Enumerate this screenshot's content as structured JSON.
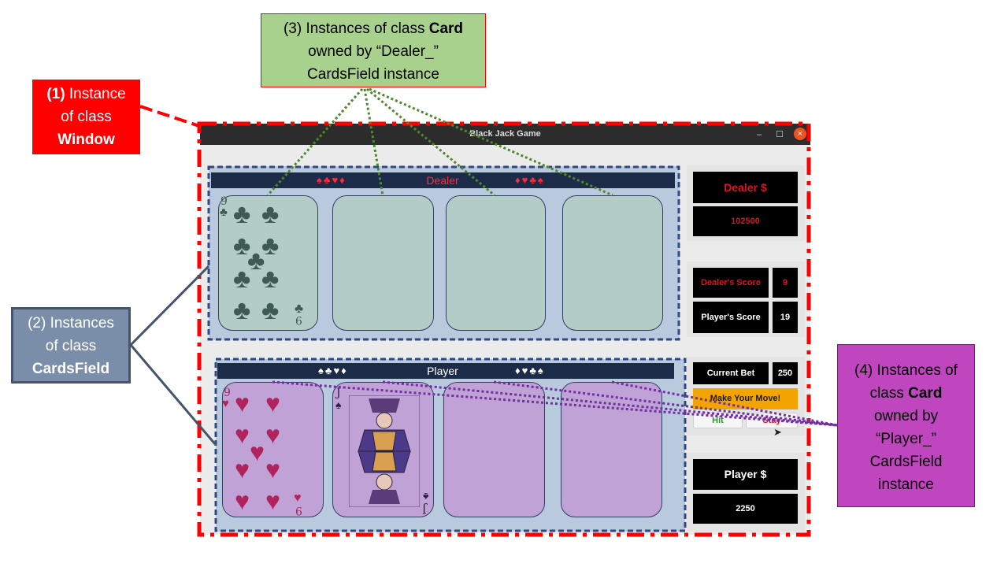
{
  "window": {
    "title": "Black Jack Game",
    "controls": {
      "minimize": "–",
      "maximize": "☐",
      "close": "×"
    }
  },
  "dealer_field": {
    "suits_left": "♠♣♥♦",
    "label": "Dealer",
    "suits_right": "♦♥♣♠",
    "card1": {
      "rank": "9",
      "suit": "♣"
    }
  },
  "player_field": {
    "suits_left": "♠♣♥♦",
    "label": "Player",
    "suits_right": "♦♥♣♠",
    "card1": {
      "rank": "9",
      "suit": "♥"
    },
    "card2": {
      "rank": "J",
      "suit": "♠"
    }
  },
  "side": {
    "dealer_money_label": "Dealer $",
    "dealer_money_value": "102500",
    "dealer_score_label": "Dealer's Score",
    "dealer_score_value": "9",
    "player_score_label": "Player's Score",
    "player_score_value": "19",
    "current_bet_label": "Current Bet",
    "current_bet_value": "250",
    "make_move_label": "Make Your Move!",
    "hit_label": "Hit",
    "stay_label": "Stay",
    "player_money_label": "Player $",
    "player_money_value": "2250"
  },
  "annotations": {
    "c1_num": "(1)",
    "c1_text1": "Instance",
    "c1_text2": "of class",
    "c1_text3": "Window",
    "c2_text1": "(2) Instances",
    "c2_text2": "of class",
    "c2_text3": "CardsField",
    "c3_text1": "(3) Instances of class",
    "c3_bold": "Card",
    "c3_text2": "owned by “Dealer_”",
    "c3_text3": "CardsField instance",
    "c4_text1": "(4) Instances of",
    "c4_text2": "class",
    "c4_bold": "Card",
    "c4_text3": "owned by",
    "c4_text4": "“Player_”",
    "c4_text5": "CardsField",
    "c4_text6": "instance"
  },
  "colors": {
    "window_outline": "#ff0000",
    "field_outline": "#2f4a82",
    "dealer_pointer": "#4e8a28",
    "player_pointer": "#7030a0",
    "cardsfield_pointer": "#44546a"
  }
}
